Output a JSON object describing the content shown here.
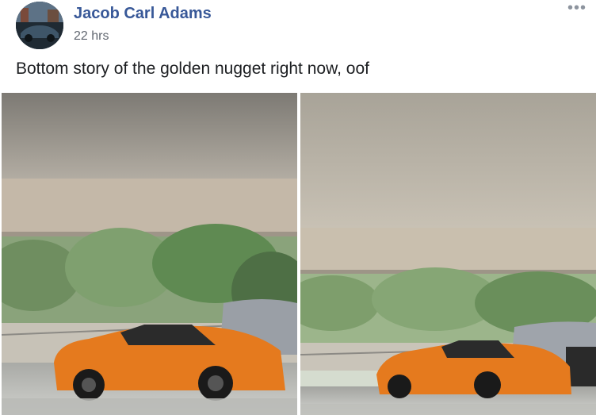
{
  "post": {
    "author": "Jacob Carl Adams",
    "timestamp": "22 hrs",
    "caption": "Bottom story of the golden nugget right now, oof",
    "more_icon": "ellipsis-icon"
  },
  "photos": [
    {
      "subject": "orange-sports-car-in-flooded-garage"
    },
    {
      "subject": "orange-sports-car-in-flooded-garage"
    }
  ],
  "colors": {
    "author_link": "#385898",
    "timestamp": "#616770",
    "caption": "#1c1e21",
    "car_orange": "#e57a1e"
  }
}
